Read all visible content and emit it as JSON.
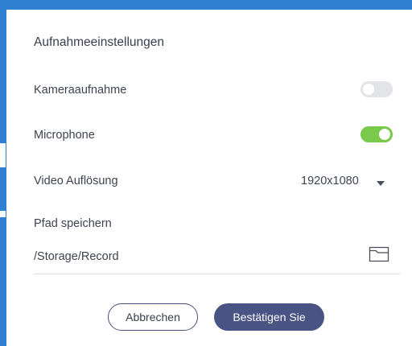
{
  "dialog": {
    "title": "Aufnahmeeinstellungen",
    "camera": {
      "label": "Kameraaufnahme",
      "enabled": false
    },
    "microphone": {
      "label": "Microphone",
      "enabled": true
    },
    "resolution": {
      "label": "Video Auflösung",
      "value": "1920x1080"
    },
    "save_path": {
      "label": "Pfad speichern",
      "value": "/Storage/Record"
    },
    "buttons": {
      "cancel": "Abbrechen",
      "confirm": "Bestätigen Sie"
    }
  },
  "colors": {
    "toggle_on": "#79c94a",
    "toggle_off": "#e3e4e8",
    "primary_button": "#495384",
    "background": "#2f7fd3"
  },
  "icons": {
    "resolution_dropdown": "caret-down-icon",
    "folder": "folder-icon"
  }
}
